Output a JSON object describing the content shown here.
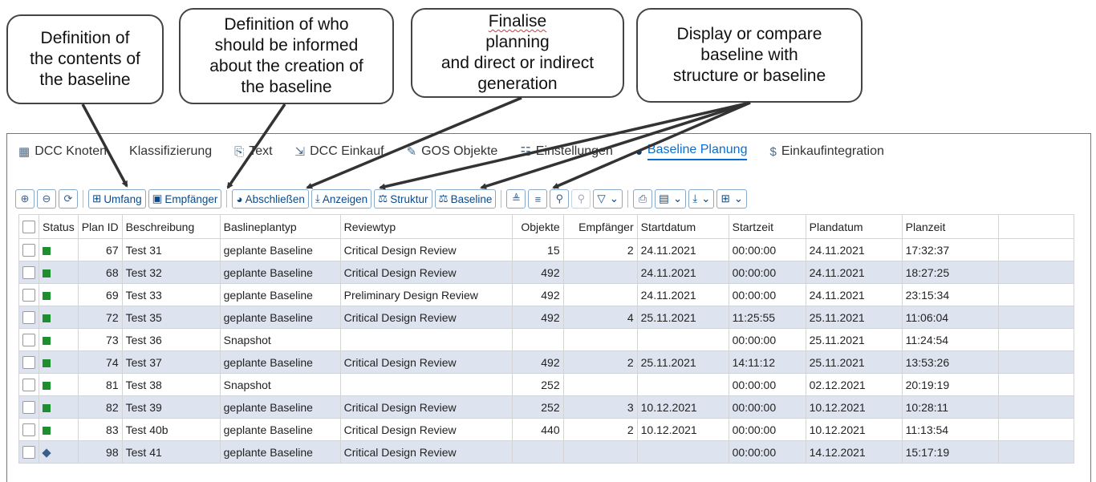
{
  "callouts": [
    {
      "lines": [
        "Definition of",
        "the contents of",
        "the baseline"
      ]
    },
    {
      "lines": [
        "Definition of who",
        "should be informed",
        "about the creation of",
        "the baseline"
      ]
    },
    {
      "lines": [
        "Finalise planning",
        "and direct or indirect",
        "generation"
      ]
    },
    {
      "lines": [
        "Display or compare",
        "baseline with",
        "structure or baseline"
      ]
    }
  ],
  "tabs": [
    {
      "label": "DCC Knoten",
      "icon": "calendar-icon",
      "active": false
    },
    {
      "label": "Klassifizierung",
      "icon": "",
      "active": false
    },
    {
      "label": "Text",
      "icon": "document-text-icon",
      "active": false
    },
    {
      "label": "DCC Einkauf",
      "icon": "purchase-icon",
      "active": false
    },
    {
      "label": "GOS Objekte",
      "icon": "attachment-icon",
      "active": false
    },
    {
      "label": "Einstellungen",
      "icon": "settings-icon",
      "active": false
    },
    {
      "label": "Baseline Planung",
      "icon": "database-icon",
      "active": true
    },
    {
      "label": "Einkaufintegration",
      "icon": "currency-icon",
      "active": false
    }
  ],
  "toolbar": {
    "umfang_label": "Umfang",
    "empfaenger_label": "Empfänger",
    "abschliessen_label": "Abschließen",
    "anzeigen_label": "Anzeigen",
    "struktur_label": "Struktur",
    "baseline_label": "Baseline"
  },
  "table": {
    "headers": [
      "Status",
      "Plan ID",
      "Beschreibung",
      "Baslineplantyp",
      "Reviewtyp",
      "Objekte",
      "Empfänger",
      "Startdatum",
      "Startzeit",
      "Plandatum",
      "Planzeit"
    ],
    "rows": [
      {
        "status": "green",
        "plan_id": "67",
        "beschreibung": "Test 31",
        "typ": "geplante Baseline",
        "review": "Critical Design Review",
        "objekte": "15",
        "empfaenger": "2",
        "startdatum": "24.11.2021",
        "startzeit": "00:00:00",
        "plandatum": "24.11.2021",
        "planzeit": "17:32:37"
      },
      {
        "status": "green",
        "plan_id": "68",
        "beschreibung": "Test 32",
        "typ": "geplante Baseline",
        "review": "Critical Design Review",
        "objekte": "492",
        "empfaenger": "",
        "startdatum": "24.11.2021",
        "startzeit": "00:00:00",
        "plandatum": "24.11.2021",
        "planzeit": "18:27:25"
      },
      {
        "status": "green",
        "plan_id": "69",
        "beschreibung": "Test 33",
        "typ": "geplante Baseline",
        "review": "Preliminary Design Review",
        "objekte": "492",
        "empfaenger": "",
        "startdatum": "24.11.2021",
        "startzeit": "00:00:00",
        "plandatum": "24.11.2021",
        "planzeit": "23:15:34"
      },
      {
        "status": "green",
        "plan_id": "72",
        "beschreibung": "Test 35",
        "typ": "geplante Baseline",
        "review": "Critical Design Review",
        "objekte": "492",
        "empfaenger": "4",
        "startdatum": "25.11.2021",
        "startzeit": "11:25:55",
        "plandatum": "25.11.2021",
        "planzeit": "11:06:04"
      },
      {
        "status": "green",
        "plan_id": "73",
        "beschreibung": "Test 36",
        "typ": "Snapshot",
        "review": "",
        "objekte": "",
        "empfaenger": "",
        "startdatum": "",
        "startzeit": "00:00:00",
        "plandatum": "25.11.2021",
        "planzeit": "11:24:54"
      },
      {
        "status": "green",
        "plan_id": "74",
        "beschreibung": "Test 37",
        "typ": "geplante Baseline",
        "review": "Critical Design Review",
        "objekte": "492",
        "empfaenger": "2",
        "startdatum": "25.11.2021",
        "startzeit": "14:11:12",
        "plandatum": "25.11.2021",
        "planzeit": "13:53:26"
      },
      {
        "status": "green",
        "plan_id": "81",
        "beschreibung": "Test 38",
        "typ": "Snapshot",
        "review": "",
        "objekte": "252",
        "empfaenger": "",
        "startdatum": "",
        "startzeit": "00:00:00",
        "plandatum": "02.12.2021",
        "planzeit": "20:19:19"
      },
      {
        "status": "green",
        "plan_id": "82",
        "beschreibung": "Test 39",
        "typ": "geplante Baseline",
        "review": "Critical Design Review",
        "objekte": "252",
        "empfaenger": "3",
        "startdatum": "10.12.2021",
        "startzeit": "00:00:00",
        "plandatum": "10.12.2021",
        "planzeit": "10:28:11"
      },
      {
        "status": "green",
        "plan_id": "83",
        "beschreibung": "Test 40b",
        "typ": "geplante Baseline",
        "review": "Critical Design Review",
        "objekte": "440",
        "empfaenger": "2",
        "startdatum": "10.12.2021",
        "startzeit": "00:00:00",
        "plandatum": "10.12.2021",
        "planzeit": "11:13:54"
      },
      {
        "status": "diamond",
        "plan_id": "98",
        "beschreibung": "Test 41",
        "typ": "geplante Baseline",
        "review": "Critical Design Review",
        "objekte": "",
        "empfaenger": "",
        "startdatum": "",
        "startzeit": "00:00:00",
        "plandatum": "14.12.2021",
        "planzeit": "15:17:19"
      }
    ]
  }
}
